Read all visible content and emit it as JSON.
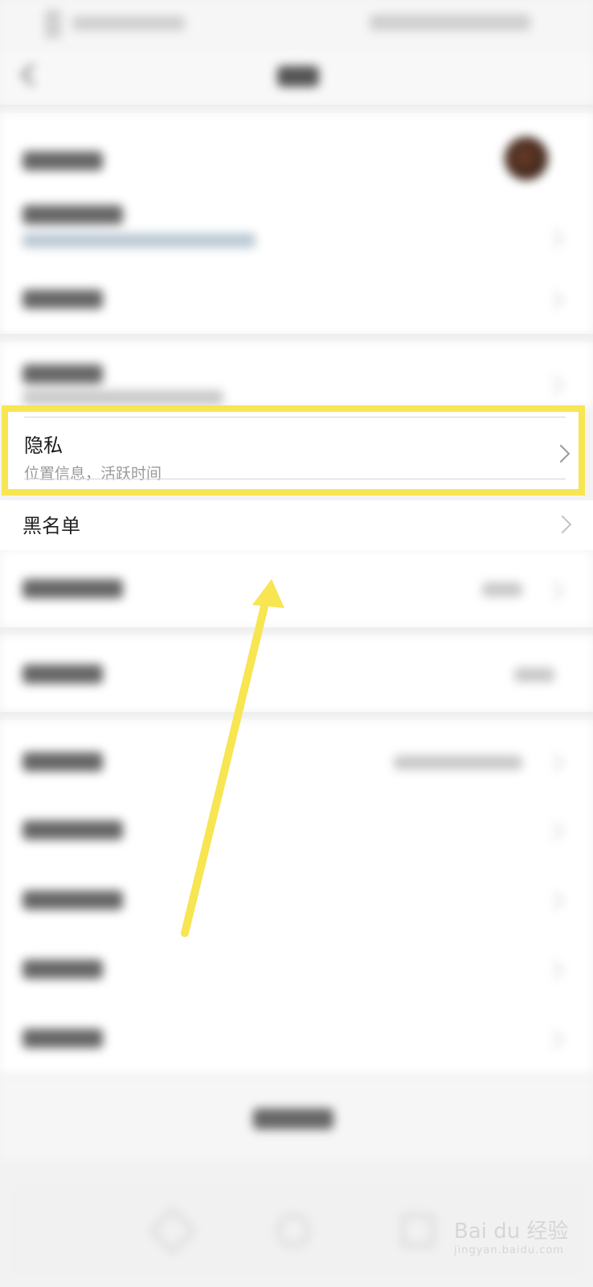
{
  "privacy_row": {
    "title": "隐私",
    "subtitle": "位置信息，活跃时间"
  },
  "blacklist_row": {
    "label": "黑名单"
  },
  "highlight_color": "#f7e552",
  "watermark": {
    "brand": "Bai du 经验",
    "url": "jingyan.baidu.com"
  },
  "icons": [
    "back-icon",
    "chevron-right-icon",
    "avatar",
    "nav-back-icon",
    "nav-home-icon",
    "nav-recents-icon"
  ]
}
